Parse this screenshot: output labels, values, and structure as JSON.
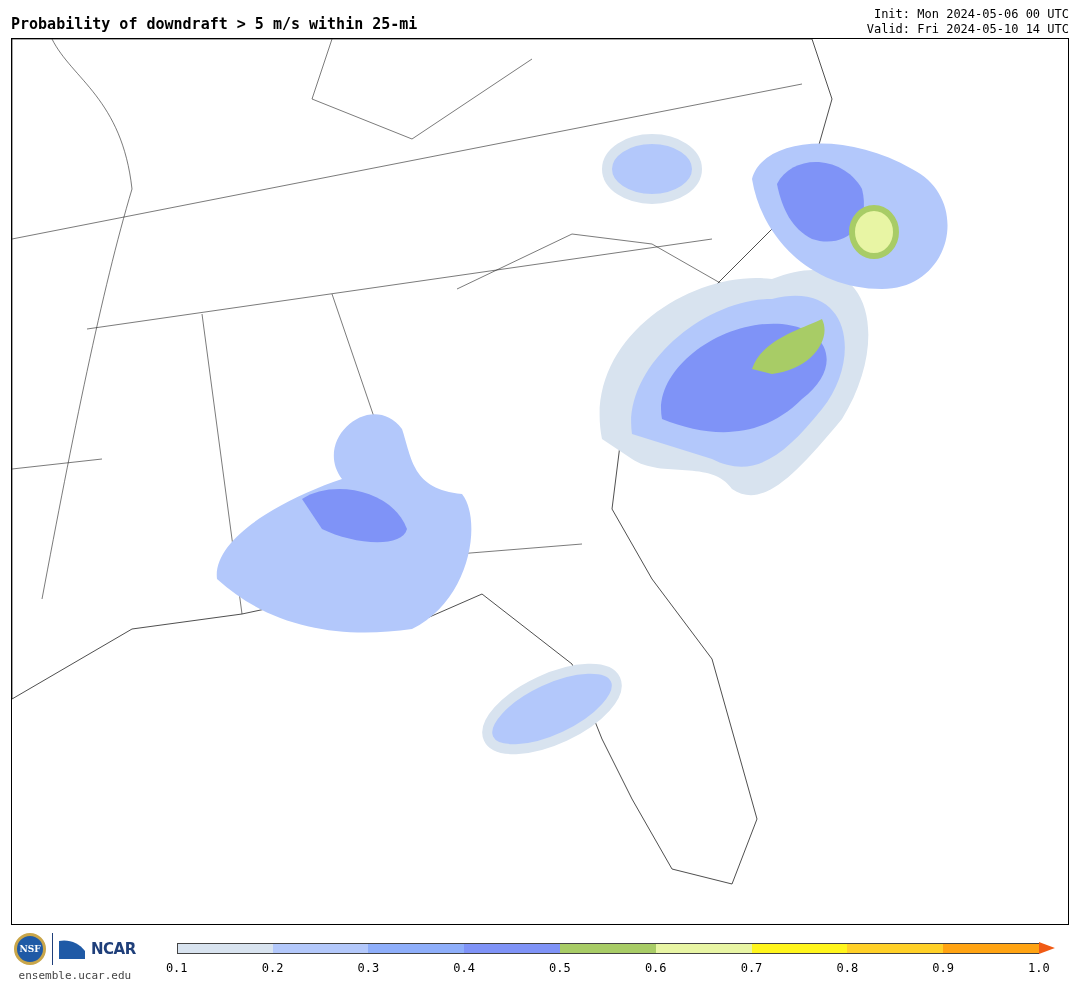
{
  "header": {
    "title": "Probability of downdraft > 5 m/s within 25-mi",
    "init": "Init: Mon 2024-05-06 00 UTC",
    "valid": "Valid: Fri 2024-05-10 14 UTC"
  },
  "logos": {
    "nsf": "NSF",
    "ncar": "NCAR",
    "site": "ensemble.ucar.edu"
  },
  "colorbar": {
    "segments": [
      {
        "kind": "box",
        "color": "#d8e3ef"
      },
      {
        "kind": "box",
        "color": "#b3c8fb"
      },
      {
        "kind": "box",
        "color": "#8eaefa"
      },
      {
        "kind": "box",
        "color": "#7f93f7"
      },
      {
        "kind": "box",
        "color": "#a8cc66"
      },
      {
        "kind": "box",
        "color": "#e8f5a4"
      },
      {
        "kind": "box",
        "color": "#fff51c"
      },
      {
        "kind": "box",
        "color": "#ffd027"
      },
      {
        "kind": "box",
        "color": "#ffa312"
      },
      {
        "kind": "arrow",
        "color": "#f05a14"
      }
    ],
    "ticks": [
      "0.1",
      "0.2",
      "0.3",
      "0.4",
      "0.5",
      "0.6",
      "0.7",
      "0.8",
      "0.9",
      "1.0"
    ]
  }
}
